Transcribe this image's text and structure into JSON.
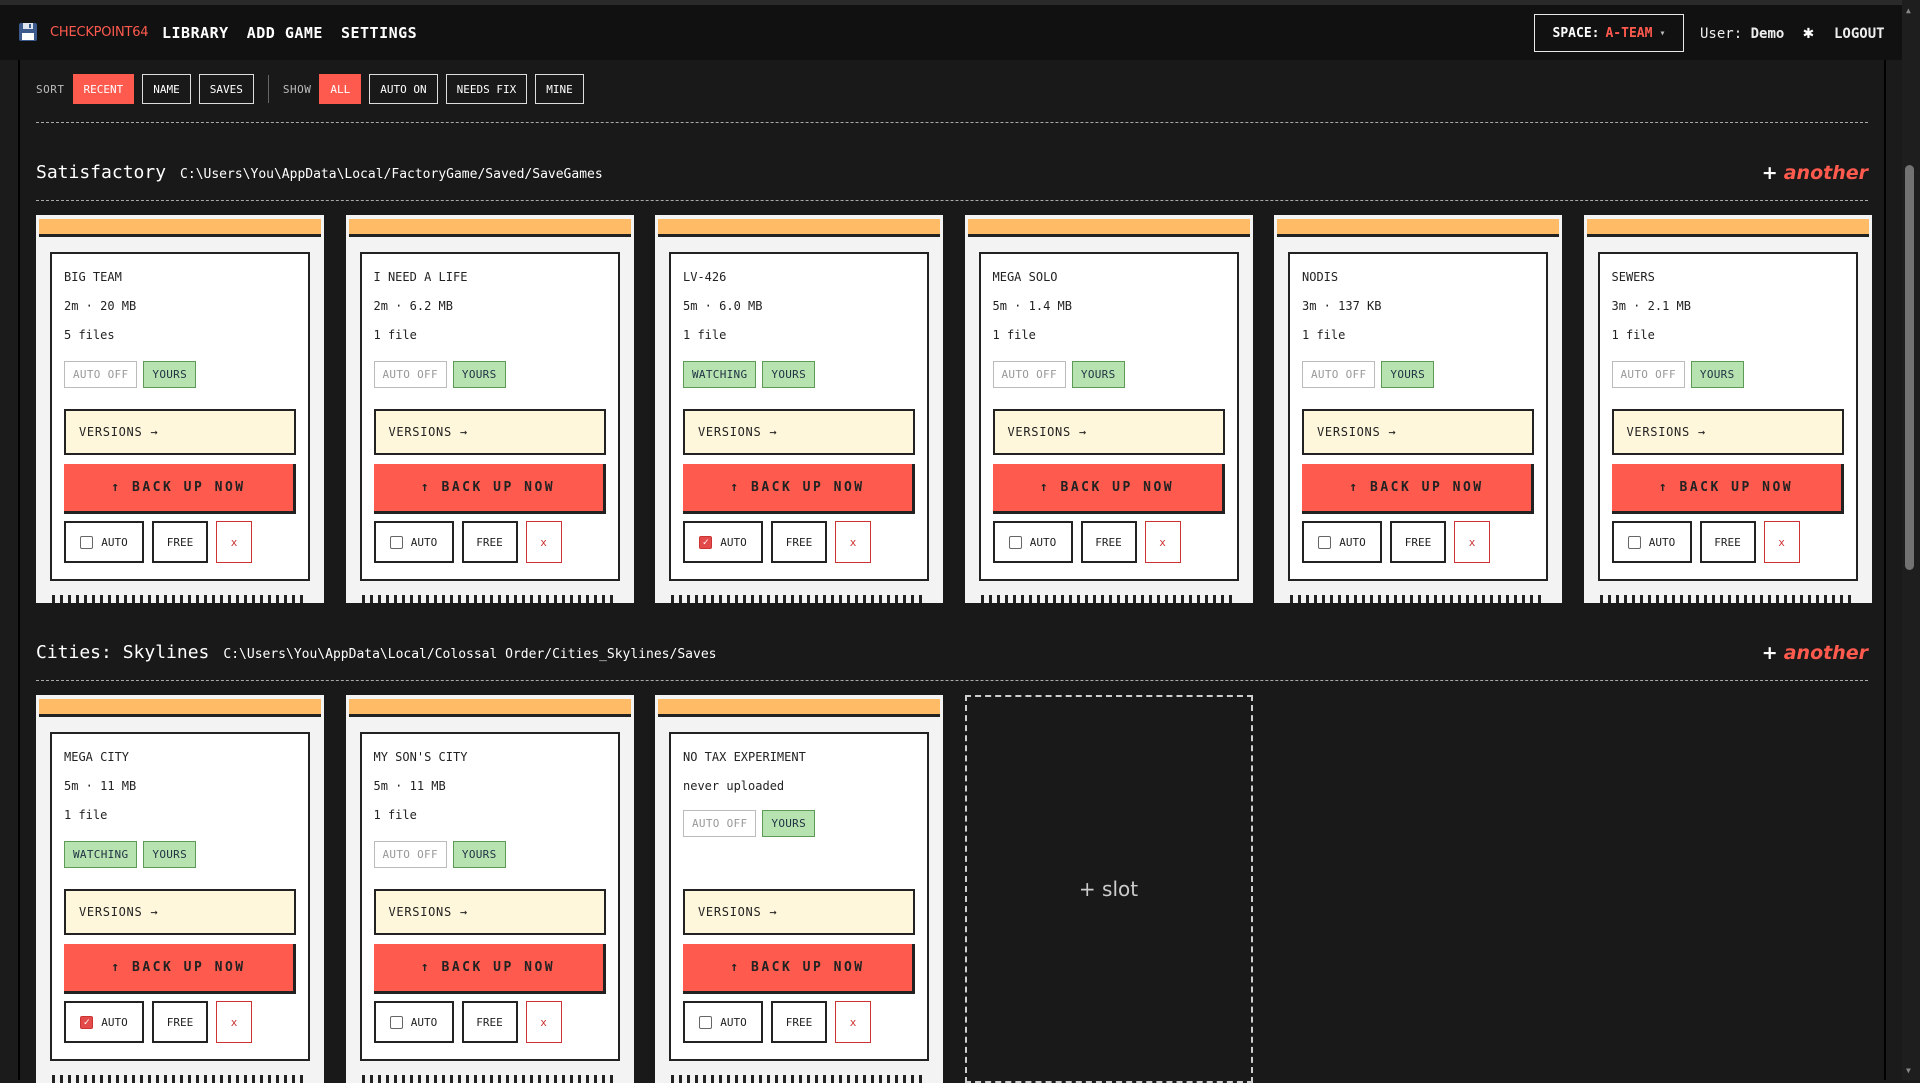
{
  "app": {
    "name": "CHECKPOINT64",
    "logo_icon": "floppy-disk-icon"
  },
  "nav": [
    "LIBRARY",
    "ADD GAME",
    "SETTINGS"
  ],
  "space": {
    "label": "SPACE:",
    "value": "A-TEAM",
    "caret": "▾"
  },
  "user": {
    "label": "User:",
    "name": "Demo"
  },
  "logout": "LOGOUT",
  "filters": {
    "sort_label": "SORT",
    "sort": [
      "RECENT",
      "NAME",
      "SAVES"
    ],
    "sort_active": "RECENT",
    "show_label": "SHOW",
    "show": [
      "ALL",
      "AUTO ON",
      "NEEDS FIX",
      "MINE"
    ],
    "show_active": "ALL"
  },
  "labels": {
    "versions": "VERSIONS →",
    "backup": "↑ BACK UP NOW",
    "auto": "AUTO",
    "free": "FREE",
    "delete": "x",
    "another": "another",
    "another_plus": "+",
    "slot": "+ slot"
  },
  "colors": {
    "accent": "#ff5a4e",
    "card_bar": "#ffbb66",
    "tag_green": "#b7e3b0",
    "versions_bg": "#fff7dc"
  },
  "games": [
    {
      "title": "Satisfactory",
      "path": "C:\\Users\\You\\AppData\\Local/FactoryGame/Saved/SaveGames",
      "saves": [
        {
          "name": "BIG TEAM",
          "meta": "2m · 20 MB",
          "files": "5 files",
          "status": "AUTO OFF",
          "owner": "YOURS",
          "auto": false
        },
        {
          "name": "I NEED A LIFE",
          "meta": "2m · 6.2 MB",
          "files": "1 file",
          "status": "AUTO OFF",
          "owner": "YOURS",
          "auto": false
        },
        {
          "name": "LV-426",
          "meta": "5m · 6.0 MB",
          "files": "1 file",
          "status": "WATCHING",
          "owner": "YOURS",
          "auto": true
        },
        {
          "name": "MEGA SOLO",
          "meta": "5m · 1.4 MB",
          "files": "1 file",
          "status": "AUTO OFF",
          "owner": "YOURS",
          "auto": false
        },
        {
          "name": "NODIS",
          "meta": "3m · 137 KB",
          "files": "1 file",
          "status": "AUTO OFF",
          "owner": "YOURS",
          "auto": false
        },
        {
          "name": "SEWERS",
          "meta": "3m · 2.1 MB",
          "files": "1 file",
          "status": "AUTO OFF",
          "owner": "YOURS",
          "auto": false
        }
      ]
    },
    {
      "title": "Cities: Skylines",
      "path": "C:\\Users\\You\\AppData\\Local/Colossal Order/Cities_Skylines/Saves",
      "saves": [
        {
          "name": "MEGA CITY",
          "meta": "5m · 11 MB",
          "files": "1 file",
          "status": "WATCHING",
          "owner": "YOURS",
          "auto": true
        },
        {
          "name": "MY SON'S CITY",
          "meta": "5m · 11 MB",
          "files": "1 file",
          "status": "AUTO OFF",
          "owner": "YOURS",
          "auto": false
        },
        {
          "name": "NO TAX EXPERIMENT",
          "meta": "never uploaded",
          "files": "",
          "status": "AUTO OFF",
          "owner": "YOURS",
          "auto": false
        }
      ]
    }
  ]
}
